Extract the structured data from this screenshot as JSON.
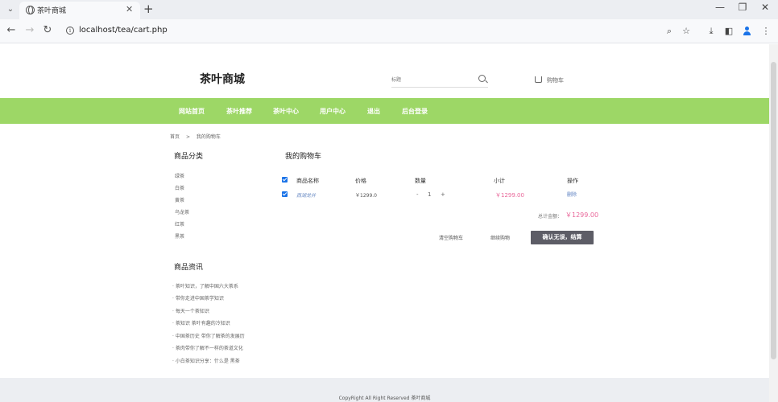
{
  "browser": {
    "tab_title": "茶叶商城",
    "url": "localhost/tea/cart.php"
  },
  "site": {
    "logo": "茶叶商城",
    "search_placeholder": "标题",
    "cart_label": "购物车"
  },
  "nav": {
    "items": [
      "网站首页",
      "茶叶推荐",
      "茶叶中心",
      "用户中心",
      "退出",
      "后台登录"
    ]
  },
  "breadcrumb": {
    "home": "首页",
    "separator": ">",
    "current": "我的购物车"
  },
  "sidebar": {
    "categories_title": "商品分类",
    "categories": [
      "绿茶",
      "白茶",
      "黄茶",
      "乌龙茶",
      "红茶",
      "黑茶"
    ],
    "news_title": "商品资讯",
    "news": [
      "· 茶叶知识，了解中国六大茶系",
      "· 带你走进中国茶学知识",
      "· 每天一个茶知识",
      "· 茶知识 茶叶有趣的冷知识",
      "· 中国茶历史 带你了解茶的发展历",
      "· 茶肉带你了解不一样的茶道文化",
      "· 小白茶知识分享：什么是 黑茶"
    ]
  },
  "cart": {
    "title": "我的购物车",
    "headers": {
      "name": "商品名称",
      "price": "价格",
      "quantity": "数量",
      "subtotal": "小计",
      "action": "操作"
    },
    "items": [
      {
        "name": "西湖龙井",
        "price": "￥1299.0",
        "minus": "-",
        "quantity": "1",
        "plus": "+",
        "subtotal": "￥1299.00",
        "action": "删除"
      }
    ],
    "total_label": "总计金额：",
    "total_value": "￥1299.00",
    "clear_label": "清空购物车",
    "continue_label": "继续购物",
    "confirm_label": "确认无误，结算"
  },
  "footer": {
    "text": "CopyRight All Right Reserved 茶叶商城"
  },
  "colors": {
    "nav_bg": "#9dd766",
    "price_accent": "#e9689a",
    "confirm_bg": "#5d5d66",
    "footer_bg": "#eceef2"
  }
}
